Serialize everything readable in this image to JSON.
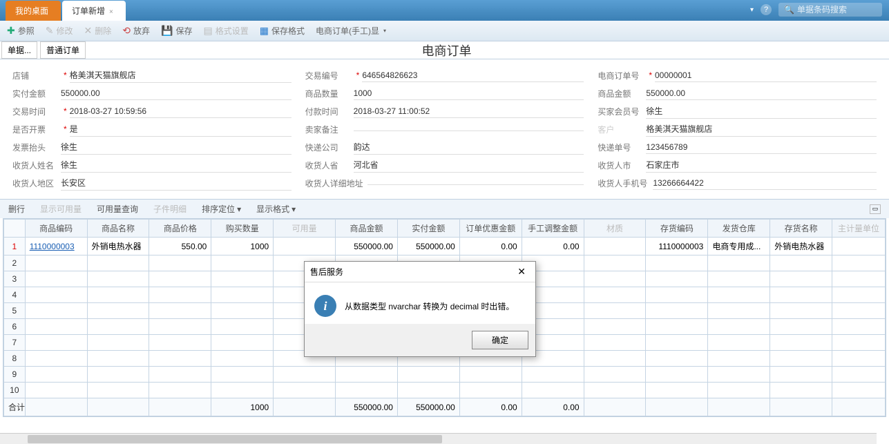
{
  "tabs": {
    "desktop": "我的桌面",
    "new_order": "订单新增"
  },
  "search": {
    "placeholder": "单据条码搜索"
  },
  "toolbar": {
    "ref": "参照",
    "edit": "修改",
    "delete": "删除",
    "discard": "放弃",
    "save": "保存",
    "fmt": "格式设置",
    "savefmt": "保存格式",
    "ecom_manual": "电商订单(手工)显"
  },
  "subbar": {
    "chip1": "单据...",
    "chip2": "普通订单",
    "title": "电商订单"
  },
  "form": {
    "shop_l": "店铺",
    "shop_v": "格美淇天猫旗舰店",
    "paidamt_l": "实付金额",
    "paidamt_v": "550000.00",
    "tradetime_l": "交易时间",
    "tradetime_v": "2018-03-27 10:59:56",
    "invoice_l": "是否开票",
    "invoice_v": "是",
    "invtitle_l": "发票抬头",
    "invtitle_v": "徐生",
    "recipient_l": "收货人姓名",
    "recipient_v": "徐生",
    "district_l": "收货人地区",
    "district_v": "长安区",
    "tradeno_l": "交易编号",
    "tradeno_v": "646564826623",
    "qty_l": "商品数量",
    "qty_v": "1000",
    "paytime_l": "付款时间",
    "paytime_v": "2018-03-27 11:00:52",
    "seller_remark_l": "卖家备注",
    "seller_remark_v": "",
    "express_co_l": "快递公司",
    "express_co_v": "韵达",
    "province_l": "收货人省",
    "province_v": "河北省",
    "addr_detail_l": "收货人详细地址",
    "addr_detail_v": "",
    "ecom_no_l": "电商订单号",
    "ecom_no_v": "00000001",
    "amt_l": "商品金额",
    "amt_v": "550000.00",
    "buyer_l": "买家会员号",
    "buyer_v": "徐生",
    "cust_l": "客户",
    "cust_v": "格美淇天猫旗舰店",
    "trackno_l": "快递单号",
    "trackno_v": "123456789",
    "city_l": "收货人市",
    "city_v": "石家庄市",
    "phone_l": "收货人手机号",
    "phone_v": "13266664422"
  },
  "inner_toolbar": {
    "delrow": "删行",
    "show_avail": "显示可用量",
    "query_avail": "可用量查询",
    "sub_detail": "子件明细",
    "sort": "排序定位",
    "dispfmt": "显示格式"
  },
  "grid": {
    "cols": {
      "code": "商品编码",
      "name": "商品名称",
      "price": "商品价格",
      "buyqty": "购买数量",
      "avail": "可用量",
      "amt": "商品金额",
      "paid": "实付金额",
      "disc": "订单优惠金额",
      "adj": "手工调整金额",
      "mat": "材质",
      "stockcode": "存货编码",
      "wh": "发货仓库",
      "stockname": "存货名称",
      "uom": "主计量单位"
    },
    "row1": {
      "n": "1",
      "code": "1110000003",
      "name": "外销电热水器",
      "price": "550.00",
      "buyqty": "1000",
      "amt": "550000.00",
      "paid": "550000.00",
      "disc": "0.00",
      "adj": "0.00",
      "stockcode": "1110000003",
      "wh": "电商专用成...",
      "stockname": "外销电热水器"
    },
    "total_l": "合计",
    "total": {
      "buyqty": "1000",
      "amt": "550000.00",
      "paid": "550000.00",
      "disc": "0.00",
      "adj": "0.00"
    }
  },
  "modal": {
    "title": "售后服务",
    "msg": "从数据类型 nvarchar 转换为 decimal 时出错。",
    "ok": "确定"
  }
}
